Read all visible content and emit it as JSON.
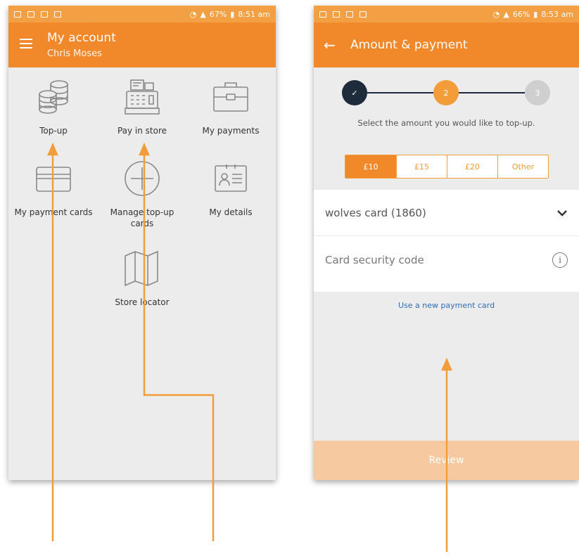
{
  "left_screen": {
    "status": {
      "battery": "67%",
      "time": "8:51 am"
    },
    "header": {
      "title": "My account",
      "subtitle": "Chris Moses"
    },
    "tiles": [
      {
        "label": "Top-up",
        "icon": "coins-icon"
      },
      {
        "label": "Pay in store",
        "icon": "cash-register-icon"
      },
      {
        "label": "My payments",
        "icon": "briefcase-icon"
      },
      {
        "label": "My payment cards",
        "icon": "credit-card-icon"
      },
      {
        "label": "Manage top-up cards",
        "icon": "plus-circle-icon"
      },
      {
        "label": "My details",
        "icon": "id-card-icon"
      },
      {
        "label": "Store locator",
        "icon": "map-icon"
      }
    ]
  },
  "right_screen": {
    "status": {
      "battery": "66%",
      "time": "8:53 am"
    },
    "header": {
      "title": "Amount & payment"
    },
    "stepper": {
      "step1": "✓",
      "step2": "2",
      "step3": "3"
    },
    "instruction": "Select the amount you would like to top-up.",
    "amounts": [
      {
        "label": "£10",
        "selected": true
      },
      {
        "label": "£15",
        "selected": false
      },
      {
        "label": "£20",
        "selected": false
      },
      {
        "label": "Other",
        "selected": false
      }
    ],
    "card_select": {
      "value": "wolves card (1860)"
    },
    "security_code": {
      "placeholder": "Card security code"
    },
    "new_card_link": "Use a new payment card",
    "review_button": "Review"
  },
  "colors": {
    "accent": "#f1882a",
    "accent_light": "#f7c9a0",
    "dark_step": "#1d2b3a",
    "link": "#2e6fb5",
    "annotation_arrow": "#f39c3a"
  }
}
